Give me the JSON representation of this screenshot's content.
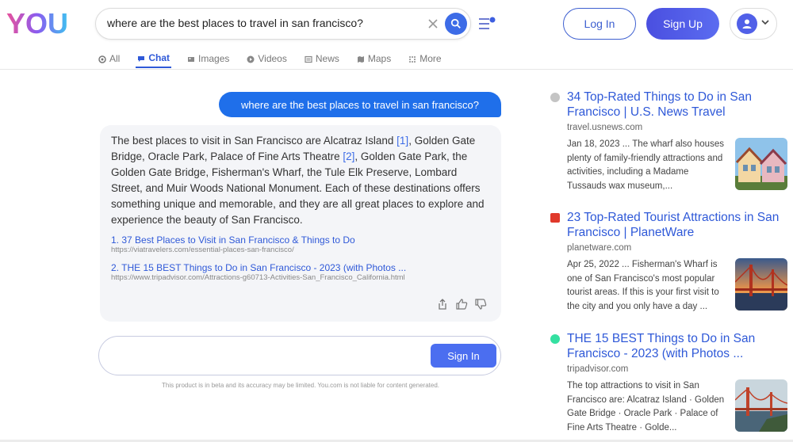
{
  "header": {
    "logo_text": "YOU",
    "search": {
      "value": "where are the best places to travel in san francisco?"
    },
    "login_label": "Log In",
    "signup_label": "Sign Up",
    "accent": "#3d6ce7"
  },
  "tabs": [
    {
      "label": "All",
      "icon": "all-icon"
    },
    {
      "label": "Chat",
      "icon": "chat-icon",
      "active": true
    },
    {
      "label": "Images",
      "icon": "image-icon"
    },
    {
      "label": "Videos",
      "icon": "video-icon"
    },
    {
      "label": "News",
      "icon": "news-icon"
    },
    {
      "label": "Maps",
      "icon": "map-icon"
    },
    {
      "label": "More",
      "icon": "more-icon"
    }
  ],
  "chat": {
    "user_message": "where are the best places to travel in san francisco?",
    "answer": {
      "p1": "The best places to visit in San Francisco are Alcatraz Island ",
      "cite1": "[1]",
      "p2": ", Golden Gate Bridge, Oracle Park, Palace of Fine Arts Theatre ",
      "cite2": "[2]",
      "p3": ", Golden Gate Park, the Golden Gate Bridge, Fisherman's Wharf, the Tule Elk Preserve, Lombard Street, and Muir Woods National Monument. Each of these destinations offers something unique and memorable, and they are all great places to explore and experience the beauty of San Francisco."
    },
    "sources": [
      {
        "title": "1. 37 Best Places to Visit in San Francisco & Things to Do",
        "url": "https://viatravelers.com/essential-places-san-francisco/"
      },
      {
        "title": "2. THE 15 BEST Things to Do in San Francisco - 2023 (with Photos ...",
        "url": "https://www.tripadvisor.com/Attractions-g60713-Activities-San_Francisco_California.html"
      }
    ],
    "signin_label": "Sign In",
    "disclaimer": "This product is in beta and its accuracy may be limited. You.com is not liable for content generated."
  },
  "results": [
    {
      "title": "34 Top-Rated Things to Do in San Francisco | U.S. News Travel",
      "domain": "travel.usnews.com",
      "snippet": "Jan 18, 2023 ... The wharf also houses plenty of family-friendly attractions and activities, including a Madame Tussauds wax museum,...",
      "favicon_color": "#bbbbbb"
    },
    {
      "title": "23 Top-Rated Tourist Attractions in San Francisco | PlanetWare",
      "domain": "planetware.com",
      "snippet": "Apr 25, 2022 ... Fisherman's Wharf is one of San Francisco's most popular tourist areas. If this is your first visit to the city and you only have a day ...",
      "favicon_color": "#e0392b"
    },
    {
      "title": "THE 15 BEST Things to Do in San Francisco - 2023 (with Photos ...",
      "domain": "tripadvisor.com",
      "snippet": "The top attractions to visit in San Francisco are: Alcatraz Island · Golden Gate Bridge · Oracle Park · Palace of Fine Arts Theatre · Golde...",
      "favicon_color": "#34e0a1"
    }
  ]
}
